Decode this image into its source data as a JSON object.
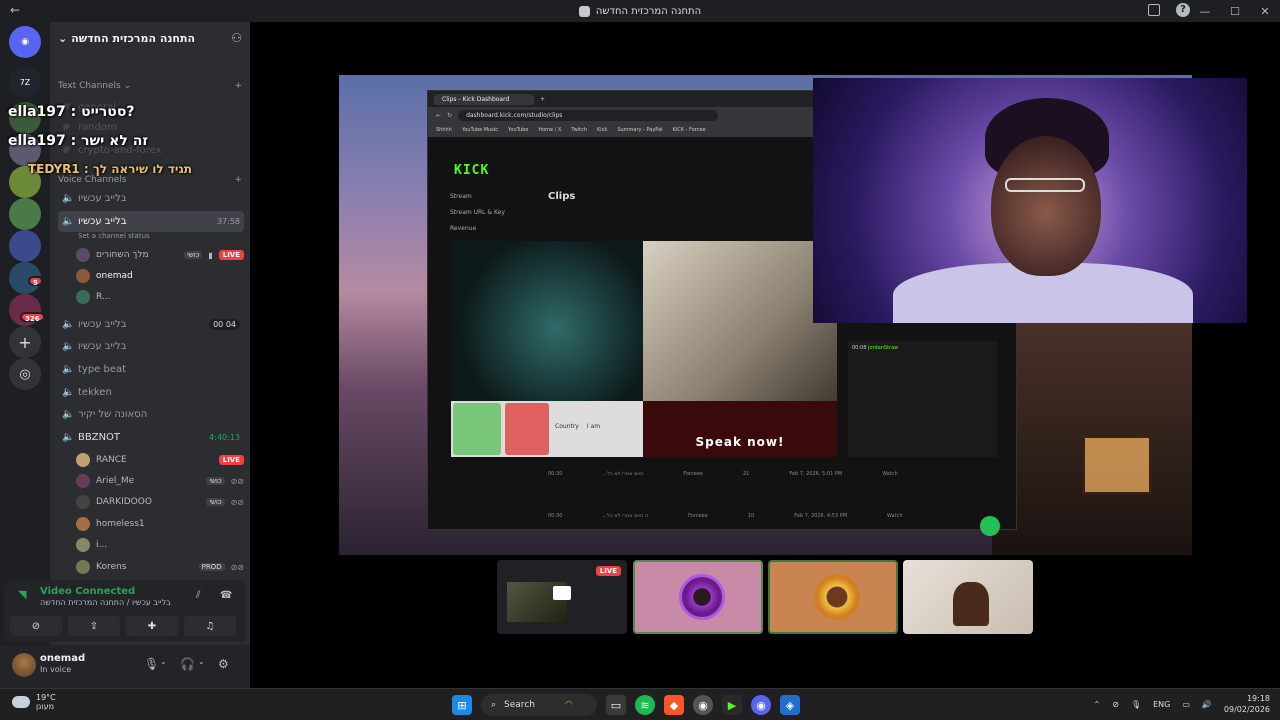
{
  "window": {
    "title": "התחנה המרכזית החדשה"
  },
  "server": {
    "name": "התחנה המרכזית החדשה"
  },
  "rail": {
    "badges": [
      "5",
      "326"
    ]
  },
  "sidebar": {
    "text_category": "Text Channels",
    "voice_category": "Voice Channels",
    "text_channels": [
      "general",
      "random",
      "crypto-and-forex"
    ],
    "voice_channels": [
      {
        "name": "בלייב עכשיו",
        "time": "",
        "count": ""
      },
      {
        "name": "בלייב עכשיו",
        "time": "37:58",
        "count": ""
      },
      {
        "name": "בלייב עכשיו",
        "time": "",
        "count": "00  04"
      },
      {
        "name": "בלייב עכשיו",
        "time": "",
        "count": ""
      },
      {
        "name": "type beat",
        "time": "",
        "count": ""
      },
      {
        "name": "tekken",
        "time": "",
        "count": ""
      },
      {
        "name": "הסאונה של יקיר",
        "time": "",
        "count": ""
      },
      {
        "name": "BBZNOT",
        "time": "4:40:13",
        "count": ""
      }
    ],
    "set_status": "Set a channel status",
    "channel_users_1": [
      {
        "name": "מלך השחורים",
        "tag": "כושי",
        "live": "LIVE"
      },
      {
        "name": "onemad",
        "tag": "",
        "live": ""
      },
      {
        "name": "R...",
        "tag": "",
        "live": ""
      }
    ],
    "channel_users_2": [
      {
        "name": "RANCE",
        "tag": "",
        "live": "LIVE"
      },
      {
        "name": "Ariel_Me",
        "tag": "כושי",
        "live": ""
      },
      {
        "name": "DARKIDOOO",
        "tag": "כושי",
        "live": ""
      },
      {
        "name": "homeless1",
        "tag": "",
        "live": ""
      },
      {
        "name": "i...",
        "tag": "",
        "live": ""
      },
      {
        "name": "Korens",
        "tag": "PROD",
        "live": ""
      }
    ]
  },
  "overlay_chat": [
    "ella197 : סטרייט?",
    "ella197 : זה לא ישר",
    "TEDYR1 : תגיד לו שיראה לך"
  ],
  "voice_status": {
    "title": "Video Connected",
    "subtitle": "בלייב עכשיו / התחנה המרכזית החדשה"
  },
  "user_panel": {
    "name": "onemad",
    "status": "In voice"
  },
  "stream": {
    "browser_tab": "Clips - Kick Dashboard",
    "url": "dashboard.kick.com/studio/clips",
    "bookmarks": [
      "Shhhh",
      "YouTube Music",
      "YouTube",
      "Home / X",
      "Twitch",
      "Kick",
      "Summary - PayPal",
      "KICK - Forcee"
    ],
    "kick_logo": "KICK",
    "menu": [
      "Stream",
      "Stream URL & Key",
      "Revenue"
    ],
    "page_title": "Clips",
    "country_label": "Country",
    "i_am_label": "I am",
    "speak_banner": "Speak now!",
    "chat_user": "JordanStraw",
    "chat_time": "00:08",
    "rows": [
      {
        "dur": "00:30",
        "title": "...היום אחרי לא כל",
        "by": "Forceee",
        "n": "21",
        "date": "Feb 7, 2026, 5:01 PM",
        "act": "Watch"
      },
      {
        "dur": "00:30",
        "title": "...ה היום אחרי לא כל",
        "by": "Forceee",
        "n": "10",
        "date": "Feb 7, 2026, 4:53 PM",
        "act": "Watch"
      }
    ]
  },
  "tiles": {
    "live_label": "LIVE"
  },
  "taskbar": {
    "temp": "19°C",
    "weather": "מעונן",
    "search": "Search",
    "lang": "ENG",
    "time": "19:18",
    "date": "09/02/2026"
  }
}
